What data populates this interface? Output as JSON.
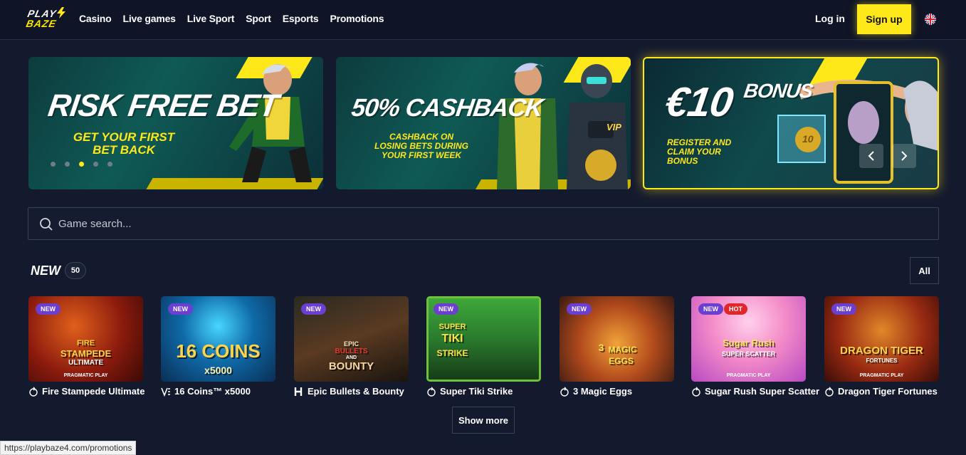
{
  "header": {
    "logo_top": "PLAY",
    "logo_bottom": "BAZE",
    "nav": [
      "Casino",
      "Live games",
      "Live Sport",
      "Sport",
      "Esports",
      "Promotions"
    ],
    "login_label": "Log in",
    "signup_label": "Sign up",
    "language_icon": "uk-flag-icon"
  },
  "banners": [
    {
      "title": "RISK FREE BET",
      "subtitle_line1": "GET YOUR FIRST",
      "subtitle_line2": "BET BACK"
    },
    {
      "title": "50% CASHBACK",
      "subtitle_line1": "CASHBACK ON",
      "subtitle_line2": "LOSING BETS DURING",
      "subtitle_line3": "YOUR FIRST WEEK",
      "badge": "VIP"
    },
    {
      "title": "€10",
      "title2": "BONUS",
      "subtitle_line1": "REGISTER AND",
      "subtitle_line2": "CLAIM YOUR",
      "subtitle_line3": "BONUS",
      "coin": "10"
    }
  ],
  "carousel": {
    "dots": 5,
    "active_index": 2
  },
  "search": {
    "placeholder": "Game search..."
  },
  "section": {
    "title": "NEW",
    "count": "50",
    "all_label": "All"
  },
  "games": [
    {
      "name": "Fire Stampede Ultimate",
      "art_line1": "FIRE",
      "art_line2": "STAMPEDE",
      "art_line3": "ULTIMATE",
      "provider_label": "PRAGMATIC PLAY",
      "badges": [
        "NEW"
      ]
    },
    {
      "name": "16 Coins™ x5000",
      "art_line1": "16 COINS",
      "art_line2": "x5000",
      "badges": [
        "NEW"
      ]
    },
    {
      "name": "Epic Bullets & Bounty",
      "art_line1": "EPIC",
      "art_line2": "BULLETS",
      "art_line3": "AND",
      "art_line4": "BOUNTY",
      "badges": [
        "NEW"
      ]
    },
    {
      "name": "Super Tiki Strike",
      "art_line1": "SUPER",
      "art_line2": "TIKI",
      "art_line3": "STRIKE",
      "badges": [
        "NEW"
      ]
    },
    {
      "name": "3 Magic Eggs",
      "art_line1": "3",
      "art_line2": "MAGIC",
      "art_line3": "EGGS",
      "badges": [
        "NEW"
      ]
    },
    {
      "name": "Sugar Rush Super Scatter",
      "art_line1": "Sugar Rush",
      "art_line2": "SUPER SCATTER",
      "provider_label": "PRAGMATIC PLAY",
      "badges": [
        "NEW",
        "HOT"
      ]
    },
    {
      "name": "Dragon Tiger Fortunes",
      "art_line1": "DRAGON TIGER",
      "art_line2": "FORTUNES",
      "provider_label": "PRAGMATIC PLAY",
      "badges": [
        "NEW"
      ]
    }
  ],
  "show_more_label": "Show more",
  "status_url": "https://playbaze4.com/promotions",
  "colors": {
    "accent": "#ffe81a",
    "background": "#141a2e",
    "badge_new": "#6b3fd1",
    "badge_hot": "#e0282c"
  }
}
